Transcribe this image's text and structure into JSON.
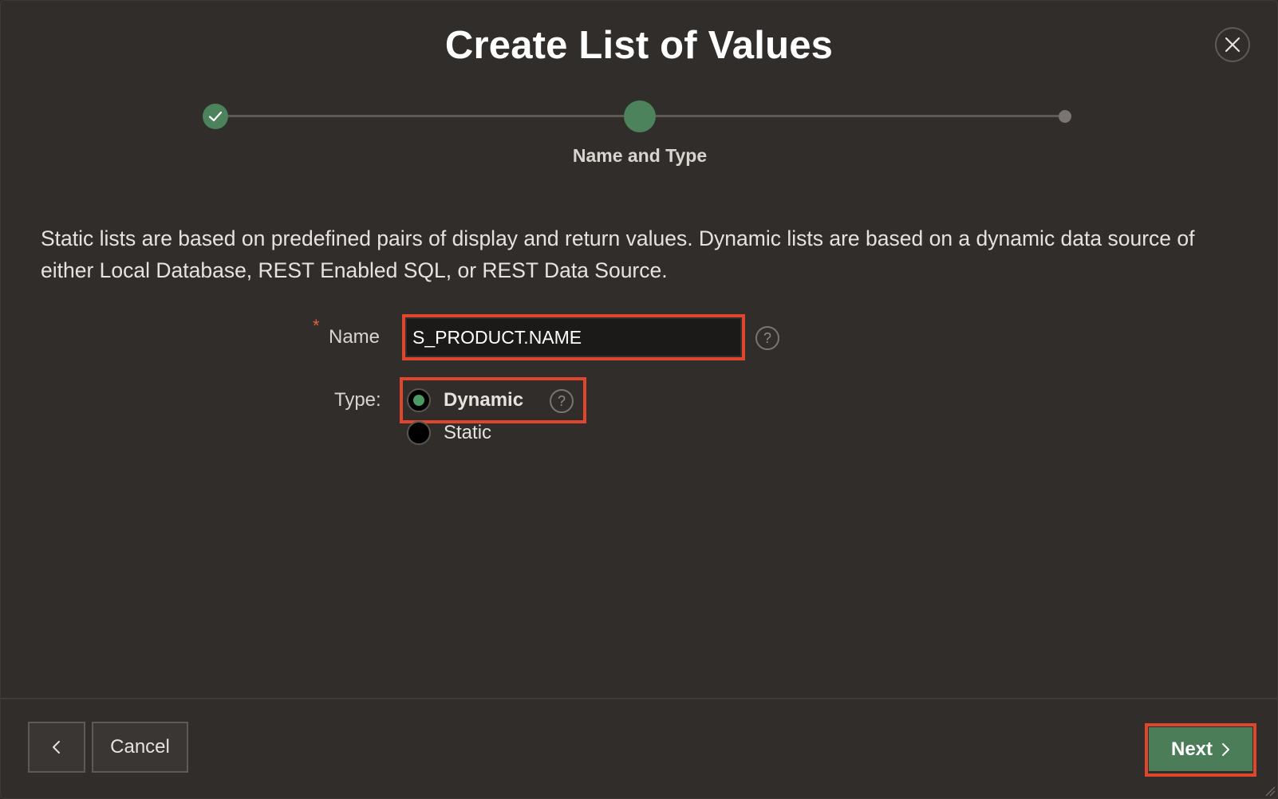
{
  "dialog": {
    "title": "Create List of Values",
    "close_icon": "close-icon"
  },
  "stepper": {
    "steps_total": 3,
    "current_step": 2,
    "current_label": "Name and Type"
  },
  "description": "Static lists are based on predefined pairs of display and return values. Dynamic lists are based on a dynamic data source of either Local Database, REST Enabled SQL, or REST Data Source.",
  "form": {
    "name_required_mark": "*",
    "name_label": "Name",
    "name_value": "S_PRODUCT.NAME",
    "name_help": "?",
    "type_label": "Type:",
    "type_options": [
      {
        "label": "Dynamic",
        "selected": true
      },
      {
        "label": "Static",
        "selected": false
      }
    ],
    "type_help": "?"
  },
  "footer": {
    "back_icon": "chevron-left-icon",
    "cancel_label": "Cancel",
    "next_label": "Next",
    "next_icon": "chevron-right-icon"
  },
  "colors": {
    "background": "#312d2a",
    "accent_green": "#4c825c",
    "highlight_red": "#e0452e",
    "required_star": "#e0603f"
  }
}
